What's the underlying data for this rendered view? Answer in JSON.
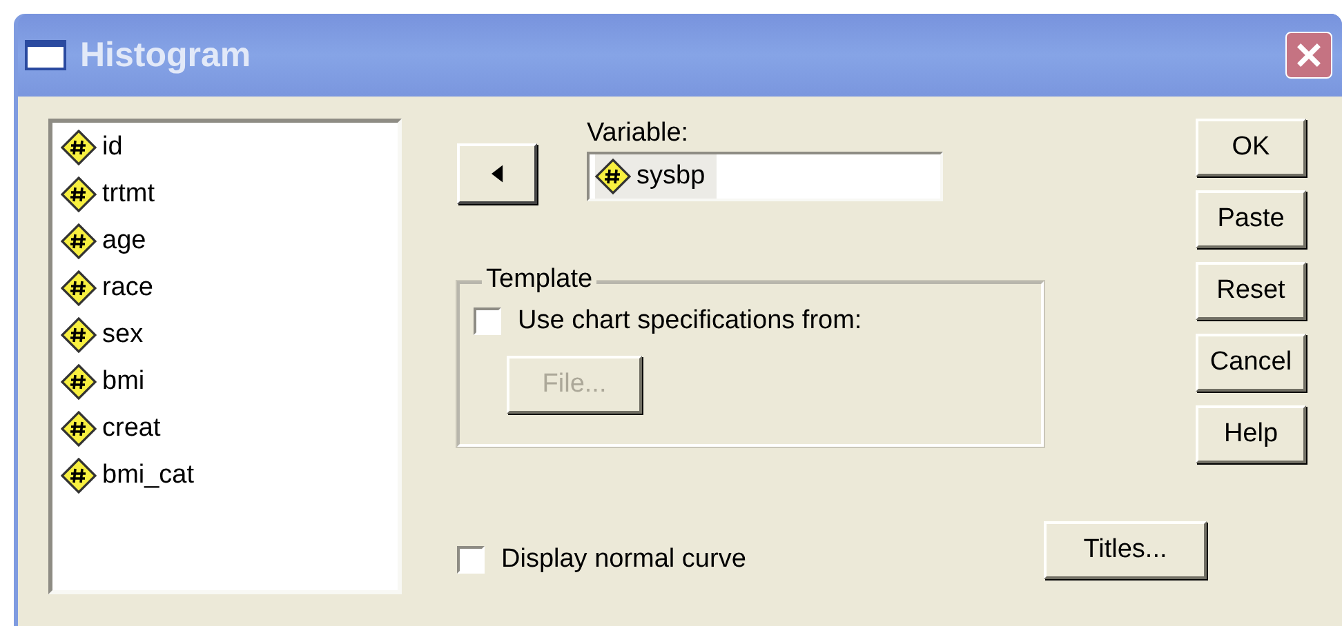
{
  "window": {
    "title": "Histogram"
  },
  "variables": [
    "id",
    "trtmt",
    "age",
    "race",
    "sex",
    "bmi",
    "creat",
    "bmi_cat"
  ],
  "target": {
    "label": "Variable:",
    "value": "sysbp"
  },
  "template": {
    "title": "Template",
    "checkbox": {
      "label": "Use chart specifications from:",
      "checked": false
    },
    "file_button": {
      "label": "File...",
      "disabled": true
    }
  },
  "normal_curve": {
    "label": "Display normal curve",
    "checked": false
  },
  "titles_button": "Titles...",
  "buttons": [
    "OK",
    "Paste",
    "Reset",
    "Cancel",
    "Help"
  ]
}
